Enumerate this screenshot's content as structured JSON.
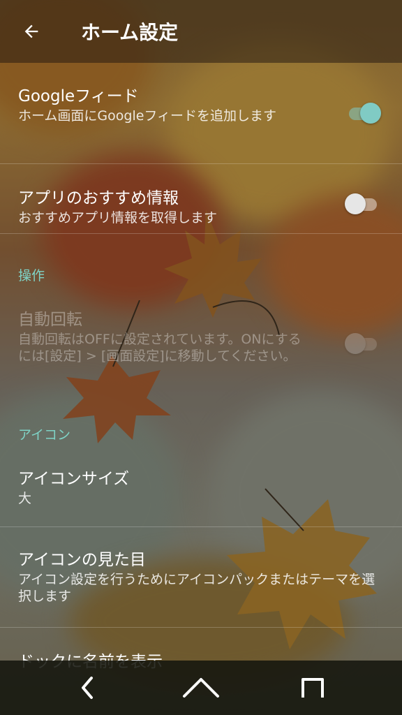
{
  "app_bar": {
    "title": "ホーム設定",
    "back_icon": "arrow-back-icon"
  },
  "colors": {
    "accent": "#7fd3c6",
    "switch_on_thumb": "#80cbc4",
    "switch_off_thumb": "#e6e6e6"
  },
  "settings": {
    "google_feed": {
      "title": "Googleフィード",
      "summary": "ホーム画面にGoogleフィードを追加します",
      "enabled": true
    },
    "app_suggestions": {
      "title": "アプリのおすすめ情報",
      "summary": "おすすめアプリ情報を取得します",
      "enabled": false
    },
    "section_operation": "操作",
    "auto_rotate": {
      "title": "自動回転",
      "summary": "自動回転はOFFに設定されています。ONにするには[設定] > [画面設定]に移動してください。",
      "enabled": false,
      "disabled": true
    },
    "section_icons": "アイコン",
    "icon_size": {
      "title": "アイコンサイズ",
      "value": "大"
    },
    "icon_look": {
      "title": "アイコンの見た目",
      "summary": "アイコン設定を行うためにアイコンパックまたはテーマを選択します"
    },
    "dock_names": {
      "title": "ドックに名前を表示"
    }
  },
  "nav_bar": {
    "back_icon": "nav-back-icon",
    "home_icon": "nav-home-icon",
    "recents_icon": "nav-recents-icon"
  }
}
